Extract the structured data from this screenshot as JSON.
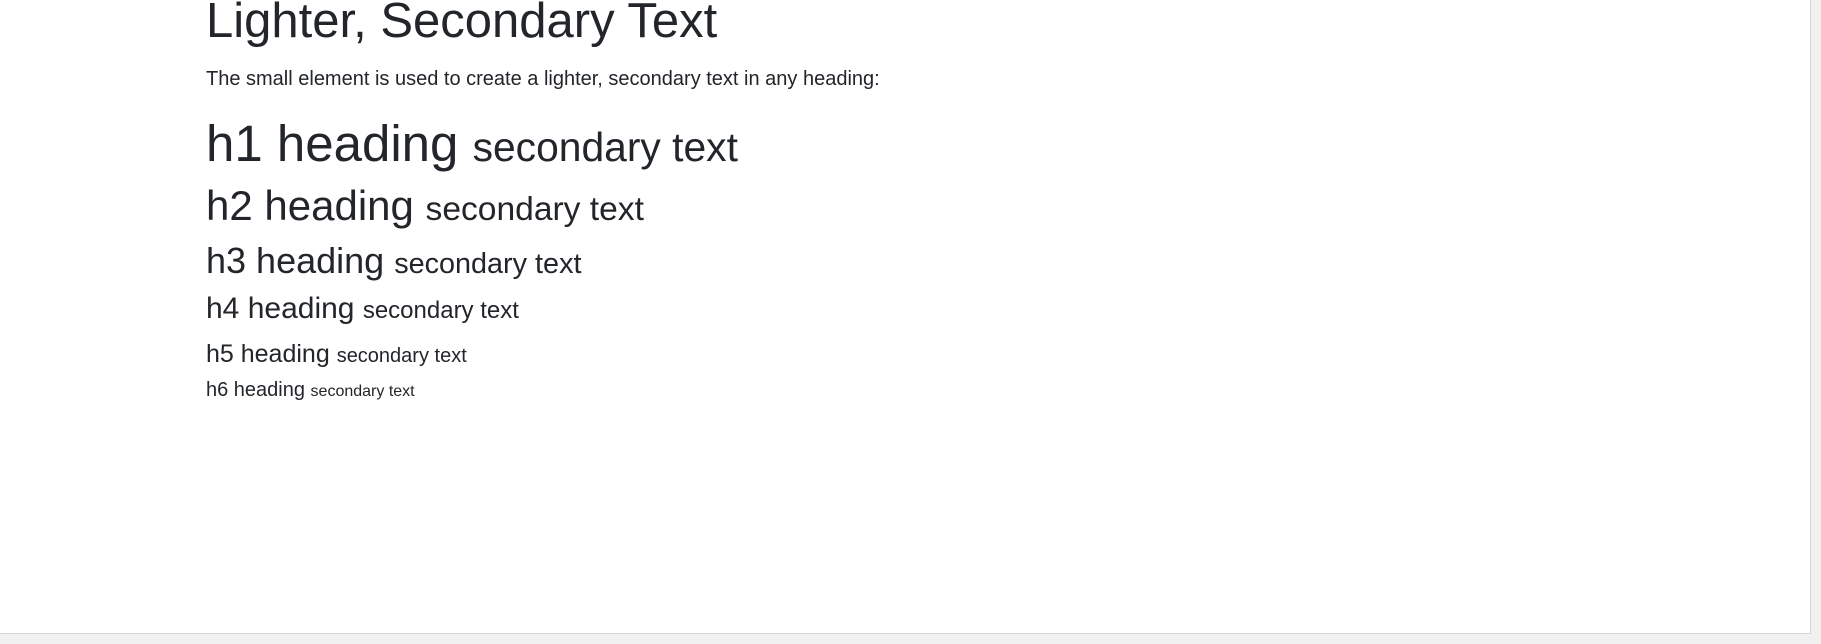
{
  "section": {
    "title": "Lighter, Secondary Text",
    "description": "The small element is used to create a lighter, secondary text in any heading:"
  },
  "headings": [
    {
      "main": "h1 heading",
      "secondary": "secondary text"
    },
    {
      "main": "h2 heading",
      "secondary": "secondary text"
    },
    {
      "main": "h3 heading",
      "secondary": "secondary text"
    },
    {
      "main": "h4 heading",
      "secondary": "secondary text"
    },
    {
      "main": "h5 heading",
      "secondary": "secondary text"
    },
    {
      "main": "h6 heading",
      "secondary": "secondary text"
    }
  ]
}
